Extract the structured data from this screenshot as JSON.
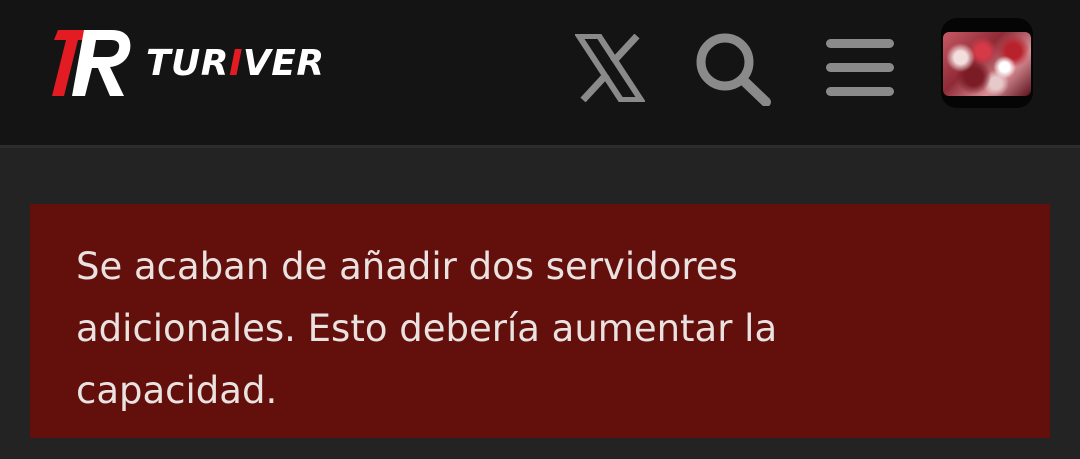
{
  "header": {
    "brand": {
      "name_part1": "TUR",
      "name_accent": "I",
      "name_part2": "VER",
      "mark_text": "TR"
    },
    "icons": [
      "x-logo-icon",
      "search-icon",
      "menu-icon"
    ],
    "avatar": "user-avatar"
  },
  "notice": {
    "message": "Se acaban de añadir dos servidores adicionales. Esto debería aumentar la capacidad."
  },
  "colors": {
    "header_bg": "#141414",
    "page_bg": "#232323",
    "notice_bg": "#63100c",
    "brand_red": "#e31b23",
    "icon_gray": "#8a8a8a"
  }
}
